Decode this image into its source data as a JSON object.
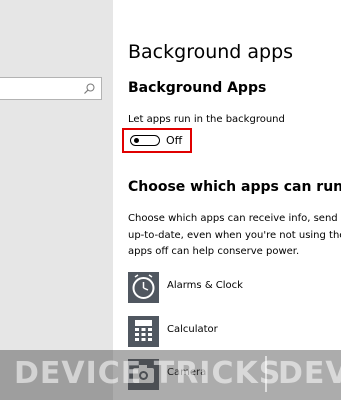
{
  "search": {
    "value": "",
    "icon": "search-icon"
  },
  "page": {
    "title": "Background apps",
    "section_title": "Background Apps",
    "toggle_label": "Let apps run in the background",
    "toggle_state": "Off",
    "toggle_on": false,
    "choose_title": "Choose which apps can run in th",
    "description_lines": [
      "Choose which apps can receive info, send n",
      "up-to-date, even when you're not using the",
      "apps off can help conserve power."
    ]
  },
  "apps": [
    {
      "label": "Alarms & Clock",
      "icon": "alarm-clock-icon"
    },
    {
      "label": "Calculator",
      "icon": "calculator-icon"
    },
    {
      "label": "Camera",
      "icon": "camera-icon"
    }
  ],
  "watermark": {
    "left": "DEVICE TRICKS",
    "right": "DEV"
  },
  "colors": {
    "highlight": "#e00000",
    "sidebar_bg": "#e6e6e6"
  }
}
